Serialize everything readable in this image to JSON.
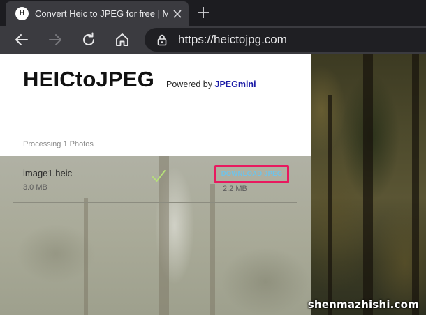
{
  "browser": {
    "tab": {
      "favicon_letter": "H",
      "title": "Convert Heic to JPEG for free | Made by JPEGmini"
    },
    "icons": {
      "tab_close": "close-icon",
      "new_tab": "plus-icon",
      "back": "arrow-left-icon",
      "forward": "arrow-right-icon",
      "reload": "reload-icon",
      "home": "home-icon",
      "lock": "lock-icon"
    },
    "address": {
      "url": "https://heictojpg.com"
    }
  },
  "page": {
    "brand_title": "HEICtoJPEG",
    "powered_by_label": "Powered by",
    "powered_by_link": "JPEGmini",
    "processing_status": "Processing 1 Photos",
    "files": [
      {
        "name": "image1.heic",
        "original_size": "3.0 MB",
        "status_icon": "checkmark-icon",
        "download_label": "DOWNLOAD JPEG",
        "output_size": "2.2 MB"
      }
    ]
  },
  "colors": {
    "download_highlight": "#e8195f",
    "download_text": "#6fc3e9",
    "check": "#b6e07a",
    "powered_link": "#1a1aa6"
  },
  "watermark": "shenmazhishi.com"
}
